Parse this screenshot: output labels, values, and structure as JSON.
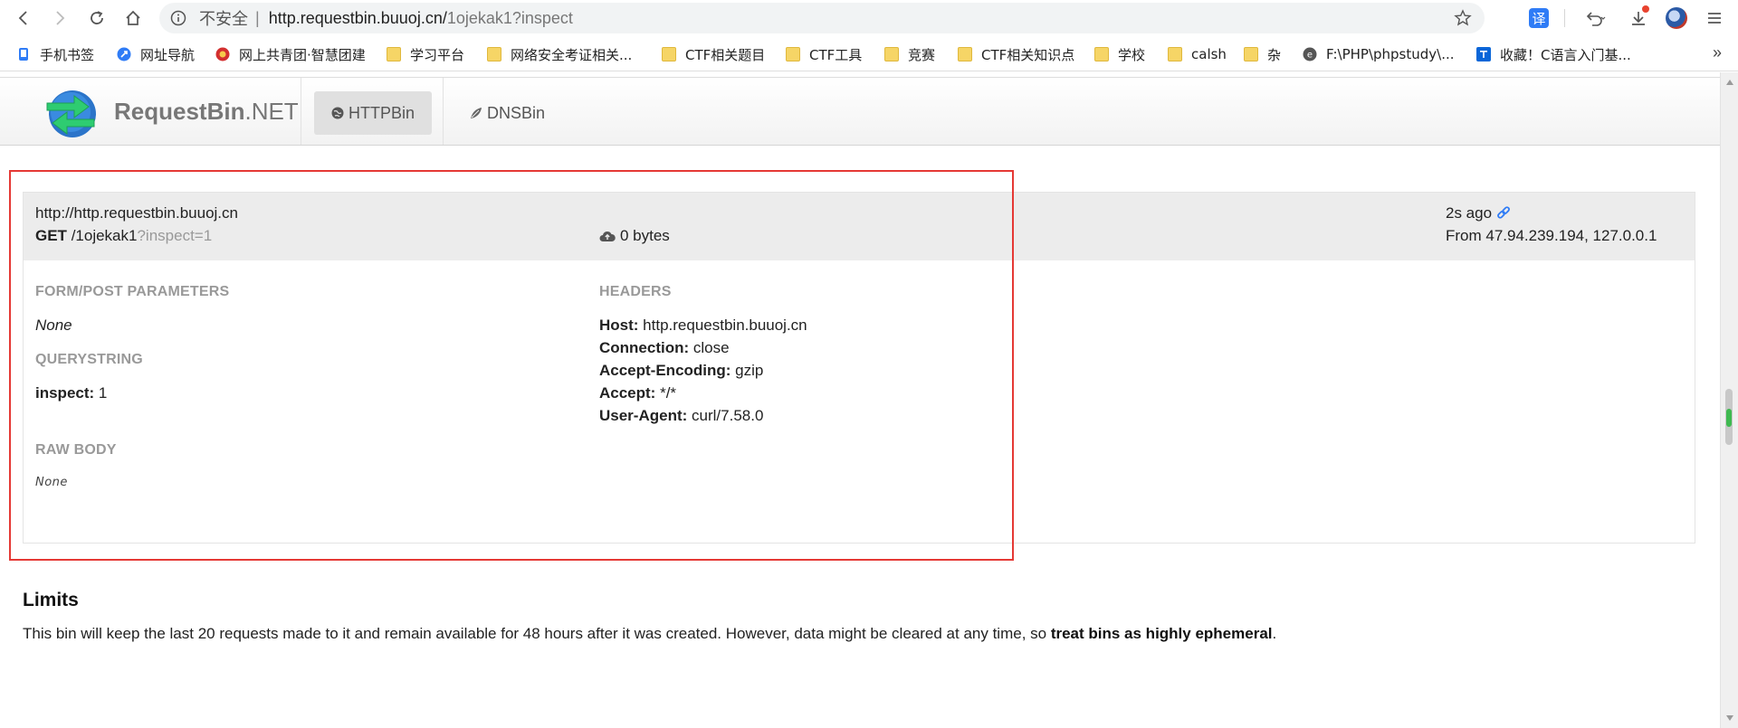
{
  "browser": {
    "security_label": "不安全",
    "address_separator": "|",
    "url_host": "http.requestbin.buuoj.cn/",
    "url_rest": "1ojekak1?inspect",
    "translate_label": "译",
    "bookmarks": [
      {
        "label": "手机书签",
        "icon": "phone-bookmark-icon"
      },
      {
        "label": "网址导航",
        "icon": "navigation-icon"
      },
      {
        "label": "网上共青团·智慧团建",
        "icon": "emblem-icon"
      },
      {
        "label": "学习平台",
        "icon": "folder-icon"
      },
      {
        "label": "网络安全考证相关...",
        "icon": "folder-icon"
      },
      {
        "label": "CTF相关题目",
        "icon": "folder-icon"
      },
      {
        "label": "CTF工具",
        "icon": "folder-icon"
      },
      {
        "label": "竞赛",
        "icon": "folder-icon"
      },
      {
        "label": "CTF相关知识点",
        "icon": "folder-icon"
      },
      {
        "label": "学校",
        "icon": "folder-icon"
      },
      {
        "label": "calsh",
        "icon": "folder-icon"
      },
      {
        "label": "杂",
        "icon": "folder-icon"
      },
      {
        "label": "F:\\PHP\\phpstudy\\...",
        "icon": "edge-icon"
      },
      {
        "label": "收藏！C语言入门基...",
        "icon": "zhihu-icon"
      }
    ],
    "more_label": "»"
  },
  "navbar": {
    "brand_main": "RequestBin",
    "brand_suffix": ".NET",
    "links": [
      {
        "label": "HTTPBin",
        "active": true
      },
      {
        "label": "DNSBin",
        "active": false
      }
    ]
  },
  "request": {
    "url": "http://http.requestbin.buuoj.cn",
    "method": "GET",
    "path": "/1ojekak1",
    "query": "?inspect=1",
    "size": "0 bytes",
    "time_ago": "2s ago",
    "from": "From 47.94.239.194, 127.0.0.1",
    "form_title": "FORM/POST PARAMETERS",
    "form_value": "None",
    "query_title": "QUERYSTRING",
    "query_params": [
      {
        "key": "inspect:",
        "value": " 1"
      }
    ],
    "raw_title": "RAW BODY",
    "raw_value": "None",
    "headers_title": "HEADERS",
    "headers": [
      {
        "key": "Host:",
        "value": " http.requestbin.buuoj.cn"
      },
      {
        "key": "Connection:",
        "value": " close"
      },
      {
        "key": "Accept-Encoding:",
        "value": " gzip"
      },
      {
        "key": "Accept:",
        "value": " */*"
      },
      {
        "key": "User-Agent:",
        "value": " curl/7.58.0"
      }
    ]
  },
  "limits": {
    "title": "Limits",
    "text_before": "This bin will keep the last 20 requests made to it and remain available for 48 hours after it was created. However, data might be cleared at any time, so ",
    "text_bold": "treat bins as highly ephemeral",
    "text_after": "."
  },
  "colors": {
    "highlight": "#e53935",
    "brand_text": "#777777"
  }
}
